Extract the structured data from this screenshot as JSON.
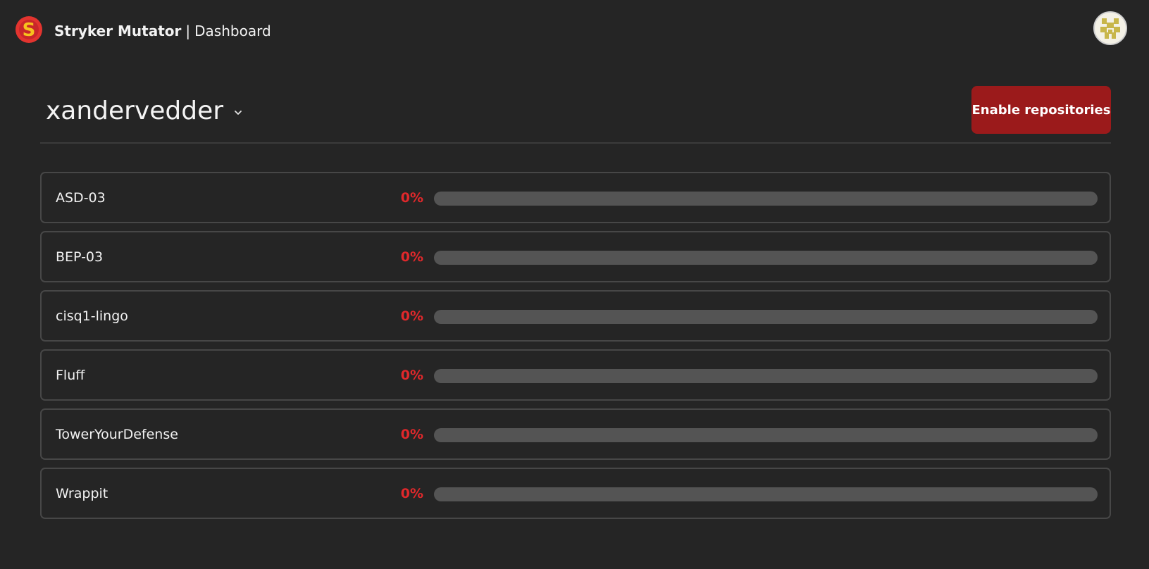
{
  "app": {
    "name": "Stryker Mutator",
    "separator": "|",
    "page": "Dashboard",
    "logo_icon": "stryker-logo-icon",
    "avatar_icon": "user-avatar-icon"
  },
  "org": {
    "name": "xandervedder",
    "dropdown_icon": "chevron-down-icon"
  },
  "actions": {
    "enable_label": "Enable repositories"
  },
  "colors": {
    "background": "#252525",
    "accent": "#9b1a1b",
    "score": "#e0282b",
    "track": "#545454",
    "border": "#474747"
  },
  "repositories": [
    {
      "name": "ASD-03",
      "score_label": "0%",
      "score": 0
    },
    {
      "name": "BEP-03",
      "score_label": "0%",
      "score": 0
    },
    {
      "name": "cisq1-lingo",
      "score_label": "0%",
      "score": 0
    },
    {
      "name": "Fluff",
      "score_label": "0%",
      "score": 0
    },
    {
      "name": "TowerYourDefense",
      "score_label": "0%",
      "score": 0
    },
    {
      "name": "Wrappit",
      "score_label": "0%",
      "score": 0
    }
  ]
}
